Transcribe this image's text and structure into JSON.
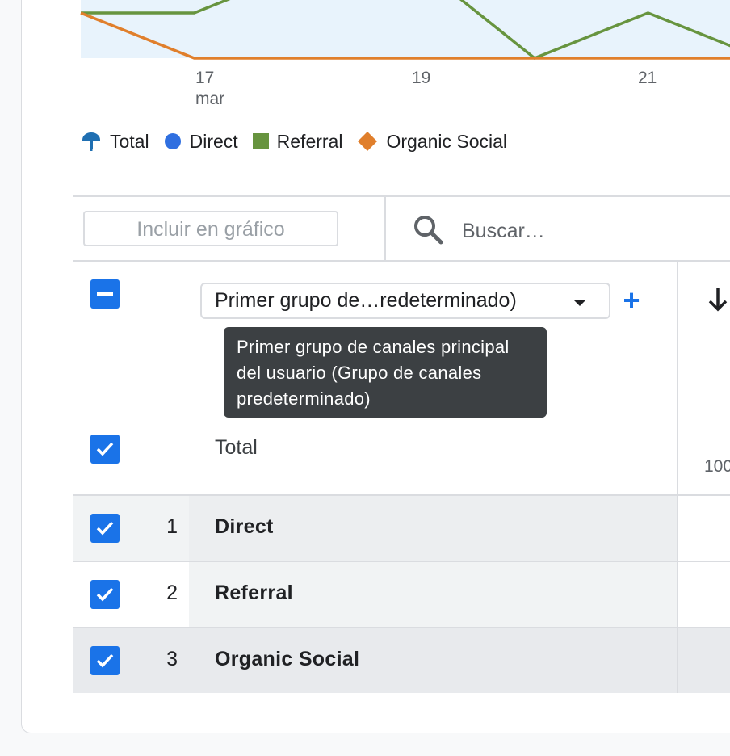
{
  "chart": {
    "x_ticks": [
      {
        "day": "17",
        "month": "mar"
      },
      {
        "day": "19",
        "month": ""
      },
      {
        "day": "21",
        "month": ""
      }
    ],
    "legend": [
      {
        "label": "Total",
        "icon": "total-marker-icon",
        "color": "#1f6fb2"
      },
      {
        "label": "Direct",
        "icon": "circle-icon",
        "color": "#2f6fe0"
      },
      {
        "label": "Referral",
        "icon": "square-icon",
        "color": "#67943f"
      },
      {
        "label": "Organic Social",
        "icon": "diamond-icon",
        "color": "#e07f2c"
      }
    ]
  },
  "chart_data": {
    "type": "line",
    "x": [
      "16",
      "17",
      "18",
      "19",
      "20",
      "21",
      "22"
    ],
    "x_tick_labels": [
      "17",
      "19",
      "21"
    ],
    "x_month_label": "mar",
    "series": [
      {
        "name": "Referral",
        "values": [
          1,
          1,
          2,
          2,
          0,
          1,
          0
        ],
        "color": "#67943f"
      },
      {
        "name": "Organic Social",
        "values": [
          1,
          0,
          0,
          0,
          0,
          0,
          0
        ],
        "color": "#e07f2c"
      }
    ],
    "fill_color": "#e8f3fc",
    "ylim": [
      0,
      4
    ]
  },
  "controls": {
    "include_in_chart_label": "Incluir en gráfico",
    "search_placeholder": "Buscar…"
  },
  "table": {
    "dimension_select": "Primer grupo de…redeterminado)",
    "add_dimension": "+",
    "tooltip": "Primer grupo de canales principal del usuario (Grupo de canales predeterminado)",
    "total_label": "Total",
    "total_value_partial": "100",
    "rows": [
      {
        "index": "1",
        "name": "Direct"
      },
      {
        "index": "2",
        "name": "Referral"
      },
      {
        "index": "3",
        "name": "Organic Social"
      }
    ]
  },
  "colors": {
    "accent": "#1a73e8",
    "row_bg": "#f1f3f4",
    "row_hover": "#e8eaed",
    "tooltip_bg": "#3c4043"
  }
}
